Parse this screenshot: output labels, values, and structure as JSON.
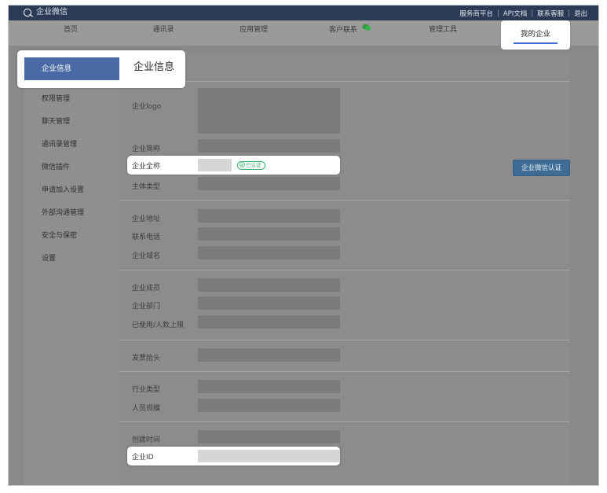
{
  "topbar": {
    "logo_text": "企业微信",
    "links": [
      "服务商平台",
      "API文档",
      "联系客服",
      "退出"
    ]
  },
  "nav": {
    "items": [
      "首页",
      "通讯录",
      "应用管理",
      "客户联系",
      "管理工具"
    ],
    "active": "我的企业"
  },
  "sidebar": {
    "active": "企业信息",
    "items": [
      "权限管理",
      "聊天管理",
      "通讯录管理",
      "微信插件",
      "申请加入设置",
      "外部沟通管理",
      "安全与保密",
      "设置"
    ]
  },
  "main": {
    "title": "企业信息",
    "fields": {
      "logo": "企业logo",
      "short_name": "企业简称",
      "full_name": "企业全称",
      "verified_badge": "已认证",
      "entity_type": "主体类型",
      "address": "企业地址",
      "phone": "联系电话",
      "domain": "企业域名",
      "members": "企业成员",
      "departments": "企业部门",
      "usage_limit": "已使用/人数上限",
      "invoice": "发票抬头",
      "industry": "行业类型",
      "staff_size": "人员规模",
      "created": "创建时间",
      "corp_id": "企业ID"
    },
    "verify_button": "企业微信认证"
  },
  "colors": {
    "topbar": "#2b3a55",
    "accent": "#3d6ad6",
    "sidebar_active": "#4a6aa5",
    "verified": "#3bb36f",
    "verify_button": "#3f6c94"
  },
  "icons": [
    "wecom-logo-icon",
    "wechat-icon",
    "check-circle-icon"
  ]
}
